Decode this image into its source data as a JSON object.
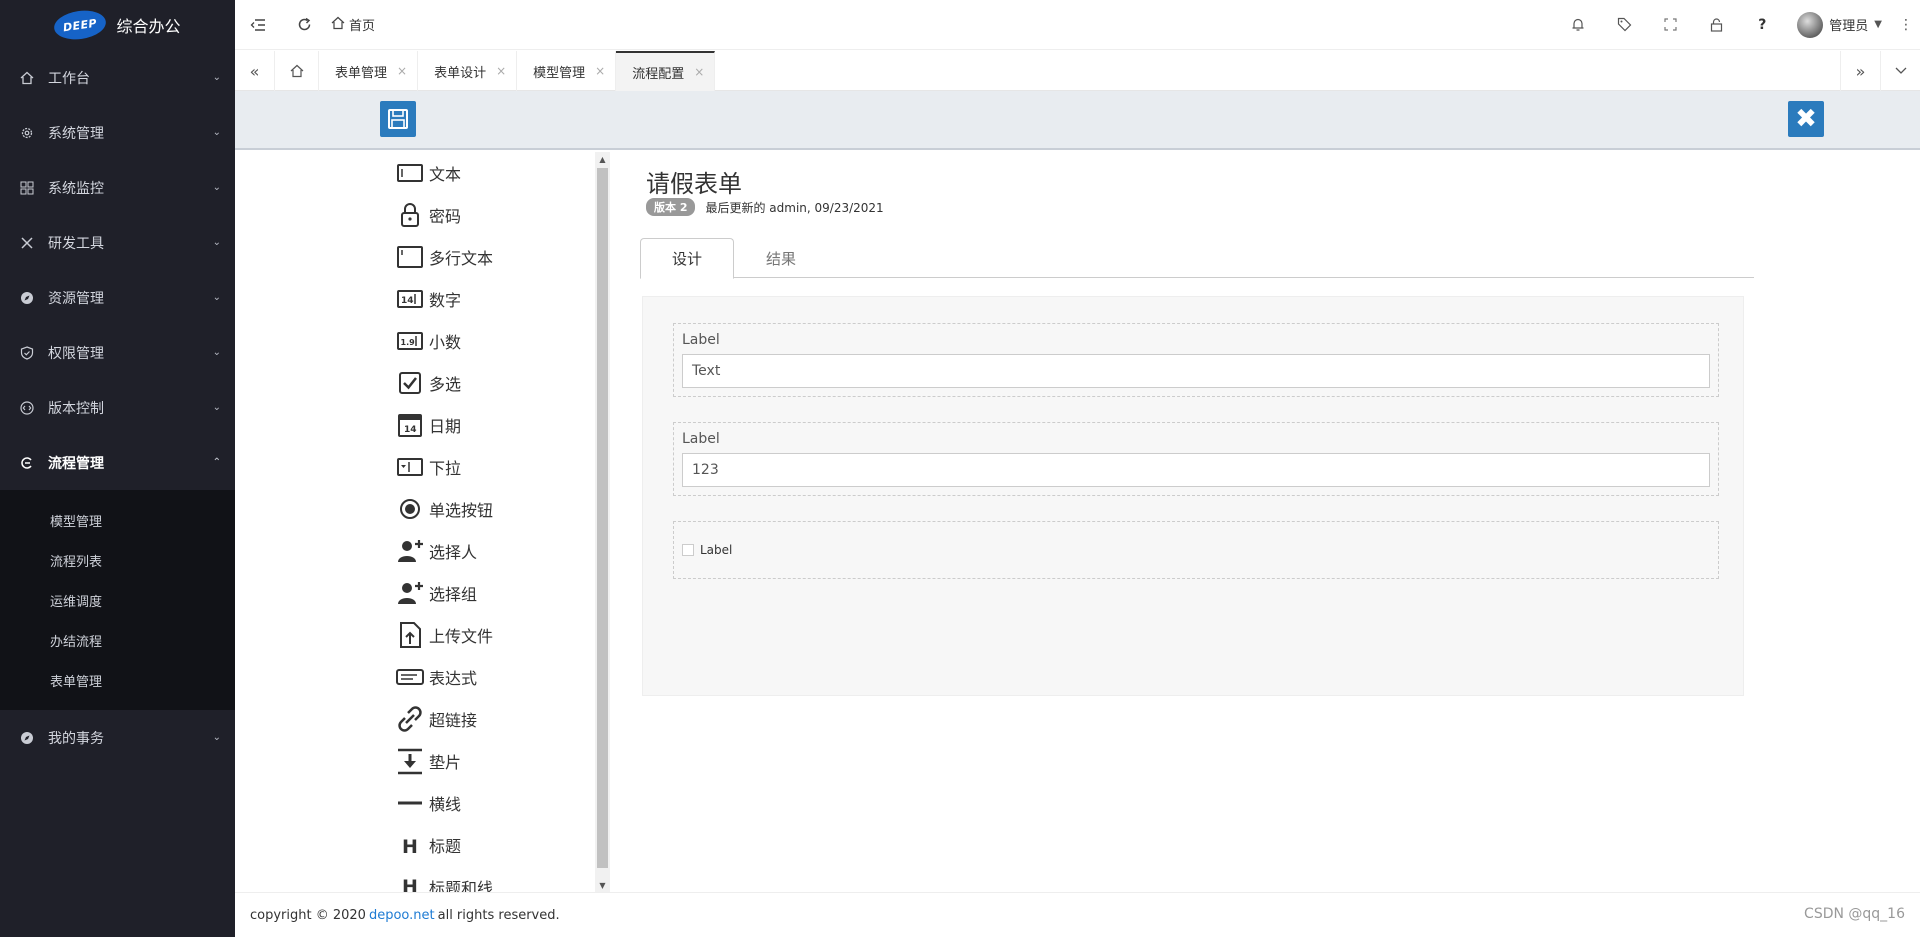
{
  "app": {
    "logo_text": "DEEP",
    "title": "综合办公"
  },
  "sidebar": {
    "items": [
      {
        "label": "工作台",
        "icon": "home-icon"
      },
      {
        "label": "系统管理",
        "icon": "gear-icon"
      },
      {
        "label": "系统监控",
        "icon": "grid-icon"
      },
      {
        "label": "研发工具",
        "icon": "tools-icon"
      },
      {
        "label": "资源管理",
        "icon": "compass-icon"
      },
      {
        "label": "权限管理",
        "icon": "shield-icon"
      },
      {
        "label": "版本控制",
        "icon": "code-icon"
      },
      {
        "label": "流程管理",
        "icon": "flow-icon"
      }
    ],
    "subitems": [
      "模型管理",
      "流程列表",
      "运维调度",
      "办结流程",
      "表单管理"
    ],
    "after": {
      "label": "我的事务",
      "icon": "compass-icon"
    }
  },
  "topbar": {
    "home_label": "首页",
    "user_name": "管理员"
  },
  "tabs": [
    {
      "label": "表单管理"
    },
    {
      "label": "表单设计"
    },
    {
      "label": "模型管理"
    },
    {
      "label": "流程配置"
    }
  ],
  "palette": [
    {
      "label": "文本",
      "icon": "text-field-icon"
    },
    {
      "label": "密码",
      "icon": "lock-icon"
    },
    {
      "label": "多行文本",
      "icon": "textarea-icon"
    },
    {
      "label": "数字",
      "icon": "number-icon"
    },
    {
      "label": "小数",
      "icon": "decimal-icon"
    },
    {
      "label": "多选",
      "icon": "checkbox-icon"
    },
    {
      "label": "日期",
      "icon": "calendar-icon"
    },
    {
      "label": "下拉",
      "icon": "dropdown-icon"
    },
    {
      "label": "单选按钮",
      "icon": "radio-icon"
    },
    {
      "label": "选择人",
      "icon": "add-user-icon"
    },
    {
      "label": "选择组",
      "icon": "add-group-icon"
    },
    {
      "label": "上传文件",
      "icon": "upload-icon"
    },
    {
      "label": "表达式",
      "icon": "expression-icon"
    },
    {
      "label": "超链接",
      "icon": "link-icon"
    },
    {
      "label": "垫片",
      "icon": "spacer-icon"
    },
    {
      "label": "横线",
      "icon": "hline-icon"
    },
    {
      "label": "标题",
      "icon": "heading-icon"
    },
    {
      "label": "标题和线",
      "icon": "heading-line-icon"
    }
  ],
  "form": {
    "title": "请假表单",
    "version_badge": "版本 2",
    "updated": "最后更新的 admin, 09/23/2021",
    "tabs": [
      "设计",
      "结果"
    ],
    "fields": [
      {
        "label": "Label",
        "value": "Text"
      },
      {
        "label": "Label",
        "value": "123"
      }
    ],
    "checkbox_label": "Label"
  },
  "footer": {
    "prefix": "copyright © 2020",
    "link": "depoo.net",
    "suffix": "all rights reserved.",
    "right": "CSDN @qq_16"
  }
}
